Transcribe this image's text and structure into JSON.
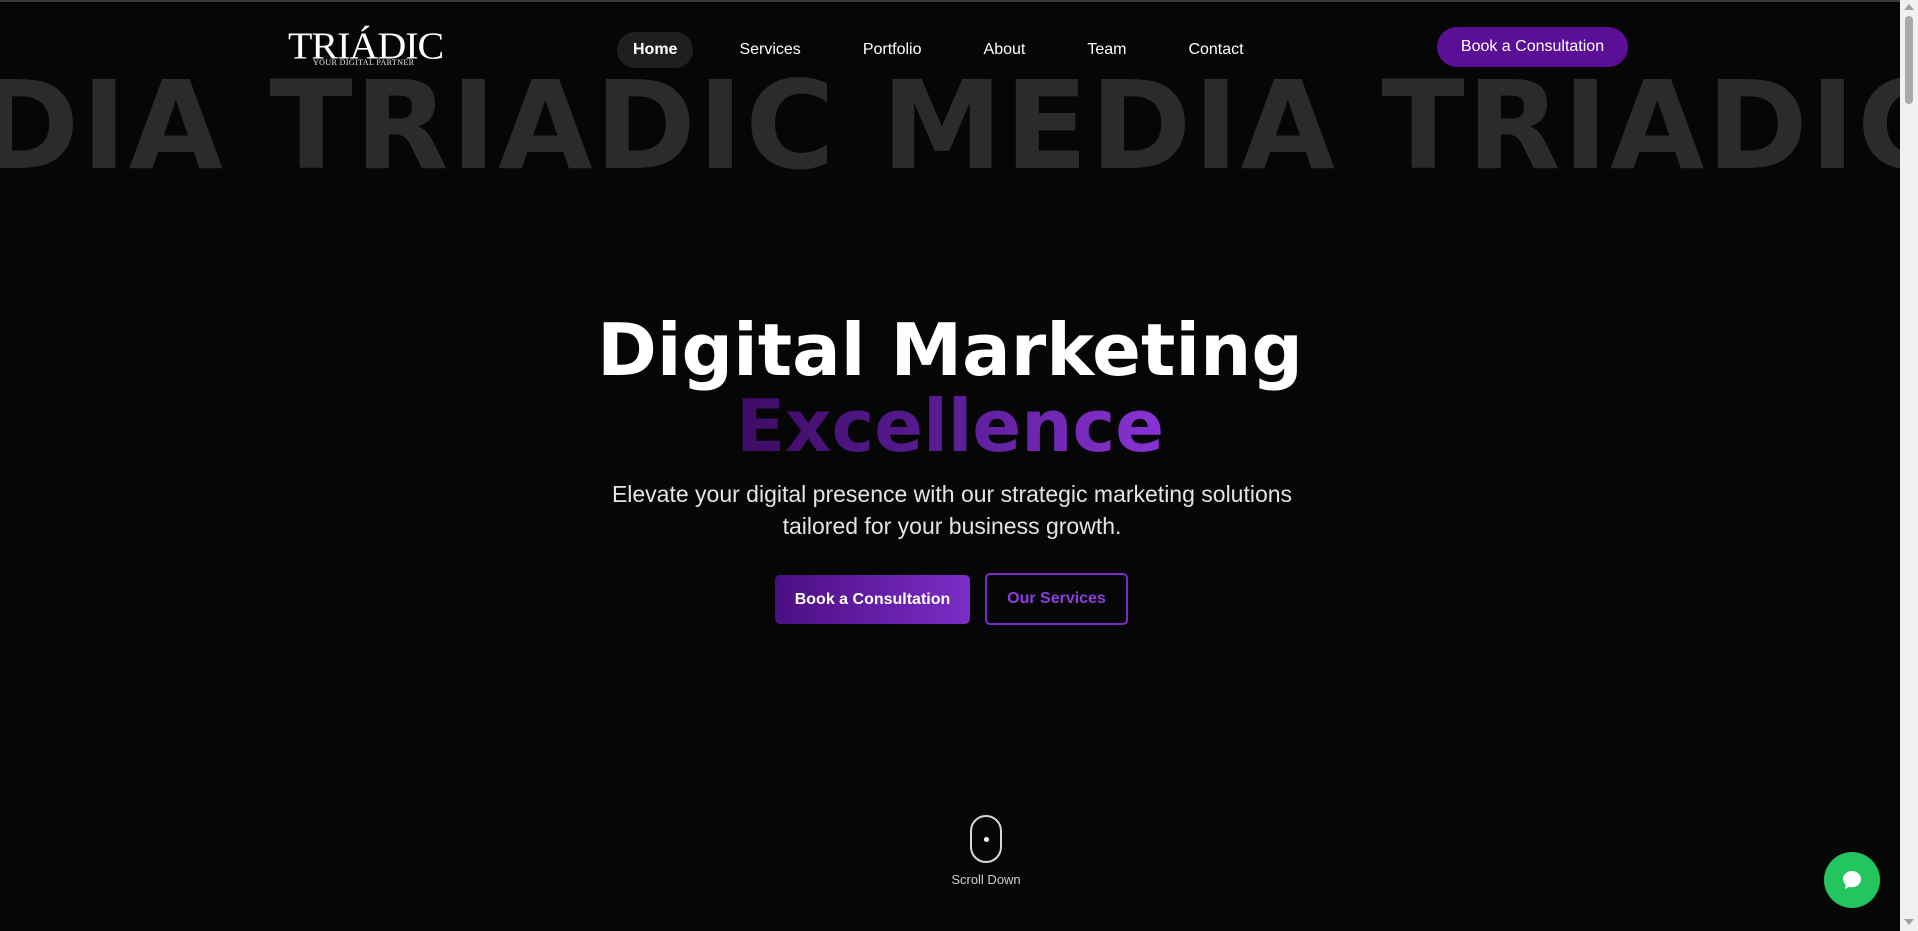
{
  "header": {
    "logo": {
      "word": "TRIÁDIC",
      "tagline": "YOUR DIGITAL PARTNER"
    },
    "nav": [
      "Home",
      "Services",
      "Portfolio",
      "About",
      "Team",
      "Contact"
    ],
    "active_nav": "Home",
    "cta_label": "Book a Consultation"
  },
  "marquee": {
    "text": "DIA TRIADIC MEDIA TRIADIC"
  },
  "hero": {
    "title_line1": "Digital Marketing",
    "title_line2": "Excellence",
    "subtitle": "Elevate your digital presence with our strategic marketing solutions tailored for your business growth.",
    "primary_button": "Book a Consultation",
    "secondary_button": "Our Services"
  },
  "scroll_indicator": {
    "label": "Scroll Down"
  },
  "chat": {
    "icon": "chat-bubble-icon"
  },
  "colors": {
    "background": "#060606",
    "accent_purple": "#5b0f97",
    "accent_purple_light": "#8a33d6",
    "chat_green": "#22c55e",
    "marquee_gray": "#2b2b2b"
  }
}
